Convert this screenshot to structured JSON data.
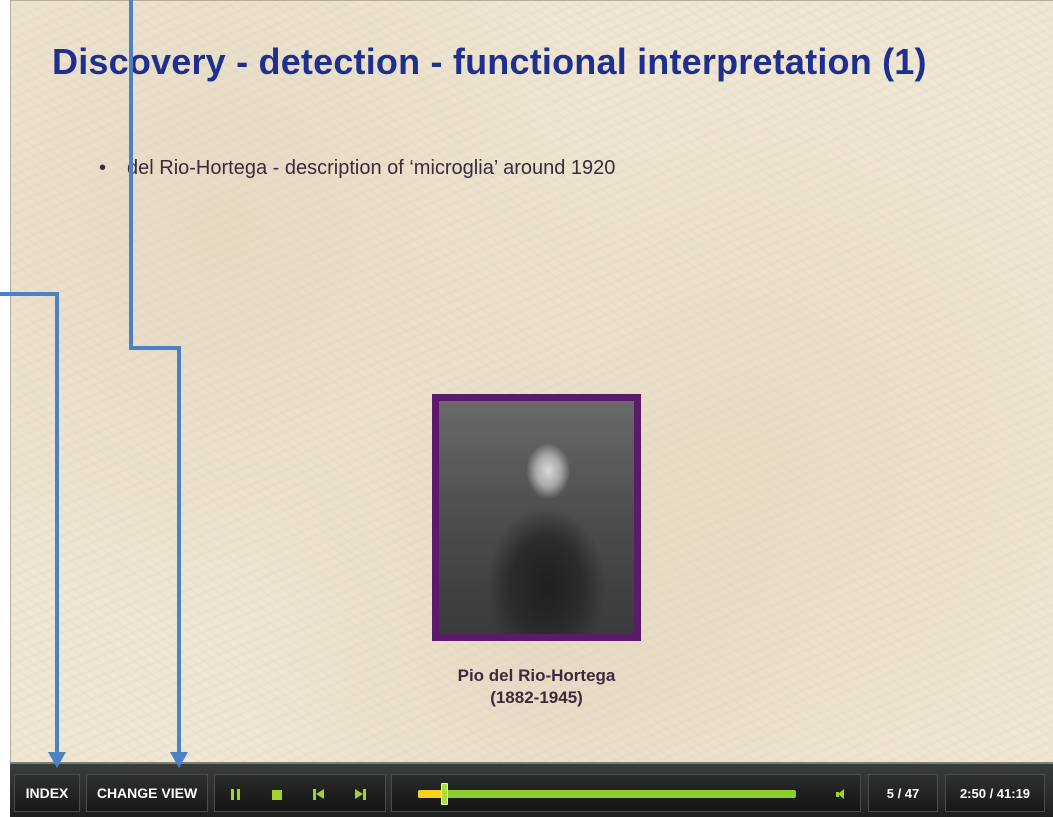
{
  "slide": {
    "title": "Discovery - detection - functional interpretation (1)",
    "bullets": [
      {
        "marker": "•",
        "text": "del Rio-Hortega - description of ‘microglia’ around 1920"
      }
    ],
    "figure": {
      "caption_name": "Pio del Rio-Hortega",
      "caption_years": "(1882-1945)"
    }
  },
  "player": {
    "index_label": "INDEX",
    "change_view_label": "CHANGE VIEW",
    "transport_icons": [
      "pause-icon",
      "stop-icon",
      "previous-slide-icon",
      "next-slide-icon",
      "volume-icon"
    ],
    "progress_fraction": 0.068,
    "slide_counter": "5 / 47",
    "time_counter": "2:50 / 41:19"
  },
  "colors": {
    "title": "#1f2f8f",
    "accent_green": "#a3d12d",
    "progress_yellow": "#f6d21e",
    "callout_blue": "#4a82c4",
    "portrait_frame": "#5b1b6a"
  }
}
